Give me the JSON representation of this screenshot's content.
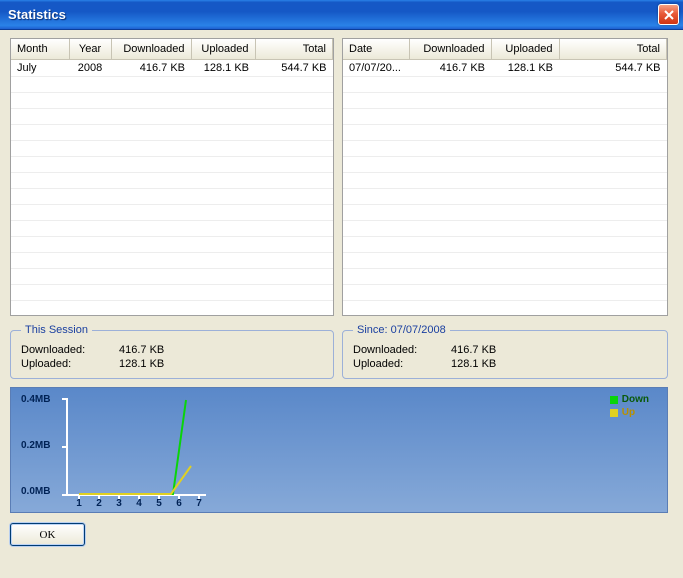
{
  "window": {
    "title": "Statistics"
  },
  "monthly_table": {
    "headers": [
      "Month",
      "Year",
      "Downloaded",
      "Uploaded",
      "Total"
    ],
    "rows": [
      {
        "month": "July",
        "year": "2008",
        "downloaded": "416.7 KB",
        "uploaded": "128.1 KB",
        "total": "544.7 KB"
      }
    ]
  },
  "daily_table": {
    "headers": [
      "Date",
      "Downloaded",
      "Uploaded",
      "Total"
    ],
    "rows": [
      {
        "date": "07/07/20...",
        "downloaded": "416.7 KB",
        "uploaded": "128.1 KB",
        "total": "544.7 KB"
      }
    ]
  },
  "session": {
    "legend": "This Session",
    "downloaded_label": "Downloaded:",
    "downloaded_value": "416.7  KB",
    "uploaded_label": "Uploaded:",
    "uploaded_value": "128.1  KB"
  },
  "since": {
    "legend": "Since: 07/07/2008",
    "downloaded_label": "Downloaded:",
    "downloaded_value": "416.7 KB",
    "uploaded_label": "Uploaded:",
    "uploaded_value": "128.1 KB"
  },
  "chart_data": {
    "type": "line",
    "x": [
      1,
      2,
      3,
      4,
      5,
      6,
      7
    ],
    "series": [
      {
        "name": "Down",
        "color": "#0ad40a",
        "values": [
          0,
          0,
          0,
          0,
          0,
          0,
          0.4
        ]
      },
      {
        "name": "Up",
        "color": "#e0d020",
        "values": [
          0,
          0,
          0,
          0,
          0,
          0,
          0.12
        ]
      }
    ],
    "yticks": [
      0.0,
      0.2,
      0.4
    ],
    "ytick_labels": [
      "0.0MB",
      "0.2MB",
      "0.4MB"
    ],
    "ylim": [
      0,
      0.4
    ],
    "legend": {
      "down": "Down",
      "up": "Up"
    }
  },
  "buttons": {
    "ok": "OK"
  }
}
